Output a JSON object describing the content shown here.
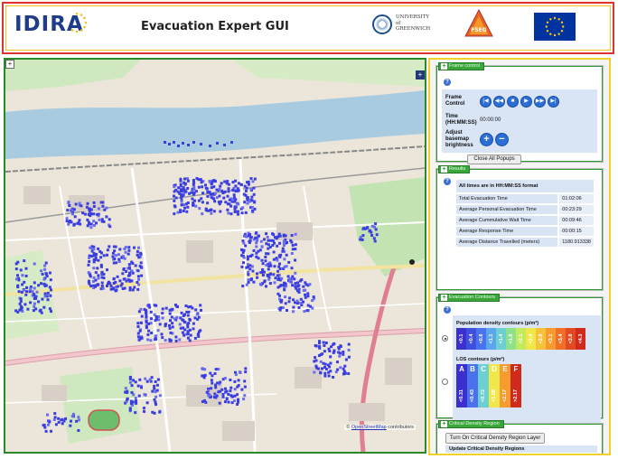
{
  "header": {
    "logo_text": "IDIRA",
    "title": "Evacuation Expert GUI",
    "university_line1": "UNIVERSITY",
    "university_line2": "of",
    "university_line3": "GREENWICH",
    "fseg_text": "FSEG",
    "eu_flag_icon": "eu-flag-icon"
  },
  "map": {
    "zoom_in_label": "+",
    "layer_toggle_label": "+",
    "attribution_symbol": "©",
    "attribution_link": "OpenStreetMap",
    "attribution_rest": "contributors"
  },
  "frame_panel": {
    "tab_label": "Frame control",
    "frame_control_label": "Frame Control",
    "time_label": "Time (HH:MM:SS)",
    "time_value": "00:00:00",
    "brightness_label": "Adjust basemap brightness",
    "close_popups_label": "Close All Popups",
    "buttons": [
      "skip-start-icon",
      "rewind-icon",
      "stop-icon",
      "play-icon",
      "fast-forward-icon",
      "skip-end-icon"
    ]
  },
  "results_panel": {
    "tab_label": "Results",
    "heading": "All times are in HH:MM:SS format",
    "rows": [
      {
        "label": "Total Evacuation Time",
        "value": "01:02:06"
      },
      {
        "label": "Average Personal Evacuation Time",
        "value": "00:23:29"
      },
      {
        "label": "Average Cummulative Wait Time",
        "value": "00:09:46"
      },
      {
        "label": "Average Response Time",
        "value": "00:00:15"
      },
      {
        "label": "Average Distance Travelled (meters)",
        "value": "1180.913338"
      }
    ]
  },
  "contours_panel": {
    "tab_label": "Evacuation Contours",
    "density_title": "Population density contours (p/m²)",
    "density_values": [
      "<0.1",
      "<0.4",
      "<0.8",
      "<1.1",
      "<1.4",
      "<1.8",
      "<2.1",
      "<2.4",
      "<2.8",
      "<3.1",
      "<3.4",
      "<3.8",
      "<4.3"
    ],
    "density_colors": [
      "#3b2fcf",
      "#3f4fe0",
      "#4a72ec",
      "#5aa7ee",
      "#6ccfd0",
      "#8fe08a",
      "#c3ea5a",
      "#f0e84a",
      "#f7c13a",
      "#f79b2e",
      "#f0702a",
      "#e34a22",
      "#d02a1c"
    ],
    "los_title": "LOS contours (p/m²)",
    "los_letters": [
      "A",
      "B",
      "C",
      "D",
      "E",
      "F"
    ],
    "los_values": [
      "<0.31",
      "<0.43",
      "<0.72",
      "<1.08",
      "<2.17",
      ">2.17"
    ],
    "los_colors": [
      "#3b2fcf",
      "#4a72ec",
      "#6ccfd0",
      "#f0e84a",
      "#f79b2e",
      "#d02a1c"
    ],
    "density_selected": true
  },
  "critical_panel": {
    "tab_label": "Critical Density Region",
    "toggle_label": "Turn On Critical Density Region Layer",
    "update_label": "Update Critical Density Regions"
  },
  "colors": {
    "header_border": "#dd3333",
    "map_border": "#2a8a2a",
    "side_border": "#f2d22a",
    "accent_blue": "#2b6fd6",
    "panel_tab_green": "#3aa63a"
  }
}
